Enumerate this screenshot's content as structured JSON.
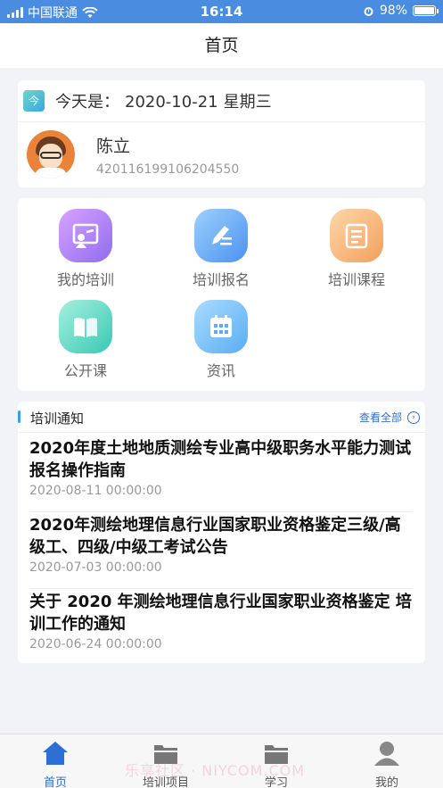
{
  "status_bar": {
    "carrier": "中国联通",
    "time": "16:14",
    "battery": "98%",
    "battery_level": 0.98
  },
  "nav": {
    "title": "首页"
  },
  "info": {
    "date_icon_text": "今",
    "date_prefix": "今天是：",
    "date": "2020-10-21",
    "weekday": "星期三",
    "user_name": "陈立",
    "user_id": "420116199106204550"
  },
  "menu": [
    {
      "label": "我的培训",
      "icon": "training-board-icon",
      "color": "#9a78f2"
    },
    {
      "label": "培训报名",
      "icon": "pen-signup-icon",
      "color": "#4c92ef"
    },
    {
      "label": "培训课程",
      "icon": "notebook-icon",
      "color": "#f4a05b"
    },
    {
      "label": "公开课",
      "icon": "open-book-icon",
      "color": "#39c8b4"
    },
    {
      "label": "资讯",
      "icon": "calendar-icon",
      "color": "#5aaef2"
    }
  ],
  "notices": {
    "header": "培训通知",
    "view_all": "查看全部",
    "items": [
      {
        "title": "2020年度土地地质测绘专业高中级职务水平能力测试报名操作指南",
        "date": "2020-08-11 00:00:00"
      },
      {
        "title": "2020年测绘地理信息行业国家职业资格鉴定三级/高级工、四级/中级工考试公告",
        "date": "2020-07-03 00:00:00"
      },
      {
        "title": "关于 2020 年测绘地理信息行业国家职业资格鉴定 培训工作的通知",
        "date": "2020-06-24 00:00:00"
      }
    ]
  },
  "tabs": [
    {
      "label": "首页",
      "icon": "home-icon",
      "active": true
    },
    {
      "label": "培训项目",
      "icon": "folder-icon",
      "active": false
    },
    {
      "label": "学习",
      "icon": "folder-icon",
      "active": false
    },
    {
      "label": "我的",
      "icon": "user-icon",
      "active": false
    }
  ],
  "watermark": "乐享社区 · NIYCOM.COM",
  "colors": {
    "accent": "#2d6fd6",
    "status_bar": "#4a8de0"
  }
}
